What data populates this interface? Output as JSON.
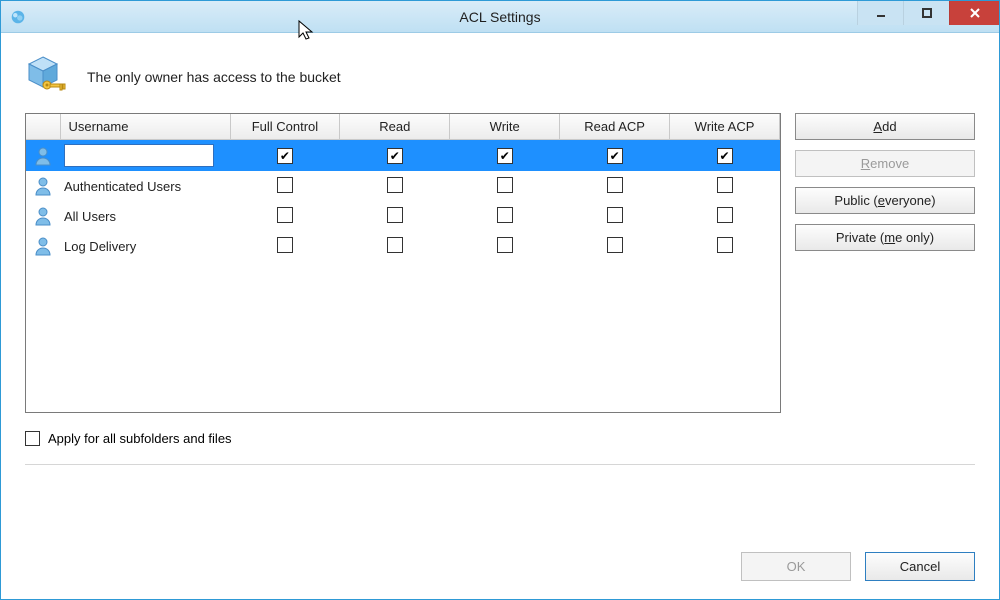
{
  "window": {
    "title": "ACL Settings"
  },
  "header": {
    "text": "The only owner has access to the bucket"
  },
  "columns": {
    "username": "Username",
    "full_control": "Full Control",
    "read": "Read",
    "write": "Write",
    "read_acp": "Read ACP",
    "write_acp": "Write ACP"
  },
  "rows": [
    {
      "name": "",
      "editing": true,
      "selected": true,
      "full_control": true,
      "read": true,
      "write": true,
      "read_acp": true,
      "write_acp": true
    },
    {
      "name": "Authenticated Users",
      "full_control": false,
      "read": false,
      "write": false,
      "read_acp": false,
      "write_acp": false
    },
    {
      "name": "All Users",
      "full_control": false,
      "read": false,
      "write": false,
      "read_acp": false,
      "write_acp": false
    },
    {
      "name": "Log Delivery",
      "full_control": false,
      "read": false,
      "write": false,
      "read_acp": false,
      "write_acp": false
    }
  ],
  "side": {
    "add": {
      "pre": "",
      "accel": "A",
      "post": "dd"
    },
    "remove": {
      "pre": "",
      "accel": "R",
      "post": "emove",
      "disabled": true
    },
    "public": {
      "pre": "Public (",
      "accel": "e",
      "post": "veryone)"
    },
    "private": {
      "pre": "Private (",
      "accel": "m",
      "post": "e only)"
    }
  },
  "apply": {
    "label": "Apply for all subfolders and files",
    "checked": false
  },
  "footer": {
    "ok": "OK",
    "cancel": "Cancel",
    "ok_disabled": true
  }
}
